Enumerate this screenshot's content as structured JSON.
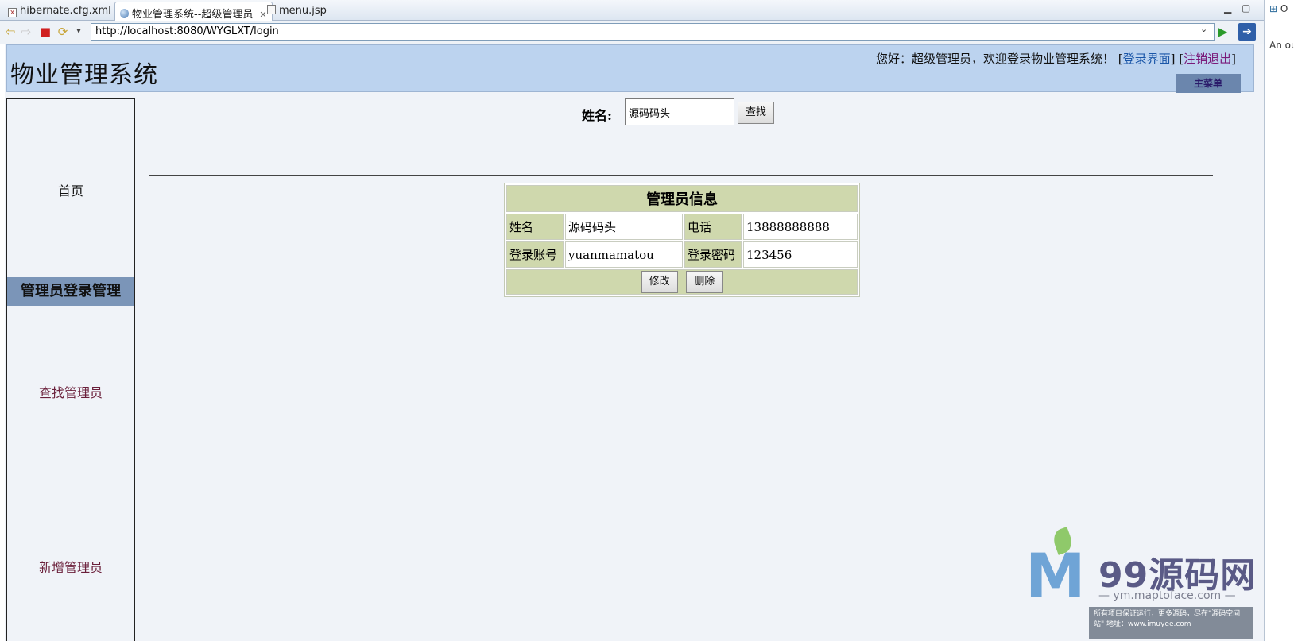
{
  "tabs": [
    {
      "label": "hibernate.cfg.xml",
      "icon": "xml-file-icon"
    },
    {
      "label": "物业管理系统--超级管理员",
      "icon": "globe-icon",
      "active": true
    },
    {
      "label": "menu.jsp",
      "icon": "jsp-file-icon"
    }
  ],
  "browser": {
    "url": "http://localhost:8080/WYGLXT/login"
  },
  "side_panel": {
    "top_text": "O",
    "sub_text": "An ou"
  },
  "header": {
    "title": "物业管理系统",
    "greeting": "您好：超级管理员，欢迎登录物业管理系统！",
    "login_link": "登录界面",
    "logout_link": "注销退出",
    "main_menu": "主菜单"
  },
  "menu": {
    "home": "首页",
    "section": "管理员登录管理",
    "find": "查找管理员",
    "add": "新增管理员"
  },
  "search": {
    "label": "姓名:",
    "value": "源码码头",
    "button": "查找"
  },
  "info": {
    "title": "管理员信息",
    "name_label": "姓名",
    "name_value": "源码码头",
    "phone_label": "电话",
    "phone_value": "13888888888",
    "account_label": "登录账号",
    "account_value": "yuanmamatou",
    "password_label": "登录密码",
    "password_value": "123456",
    "edit_button": "修改",
    "delete_button": "删除"
  },
  "watermark": {
    "brand": "99源码网",
    "url": "— ym.maptoface.com —",
    "note": "所有项目保证运行，更多源码，尽在\"源码空间站\"  地址：www.imuyee.com"
  }
}
